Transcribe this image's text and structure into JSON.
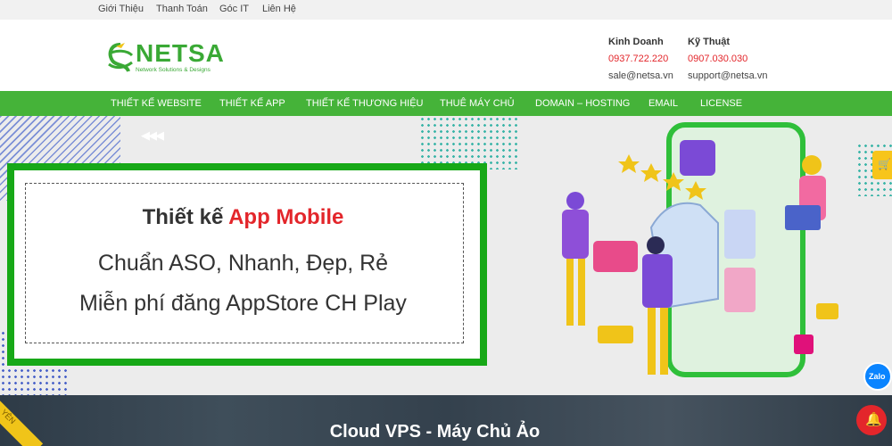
{
  "topbar": {
    "links": [
      "Giới Thiệu",
      "Thanh Toán",
      "Góc IT",
      "Liên Hệ"
    ]
  },
  "header": {
    "logo_text": "NETSA",
    "logo_tagline": "Network Solutions & Designs",
    "sales": {
      "title": "Kinh Doanh",
      "phone": "0937.722.220",
      "email": "sale@netsa.vn"
    },
    "tech": {
      "title": "Kỹ Thuật",
      "phone": "0907.030.030",
      "email": "support@netsa.vn"
    }
  },
  "nav": {
    "items": [
      "THIẾT KẾ WEBSITE",
      "THIẾT KẾ APP",
      "THIẾT KẾ THƯƠNG HIỆU",
      "THUÊ MÁY CHỦ",
      "DOMAIN – HOSTING",
      "EMAIL",
      "LICENSE"
    ]
  },
  "hero": {
    "title_prefix": "Thiết kế",
    "title_highlight": "App Mobile",
    "line2": "Chuẩn ASO, Nhanh, Đẹp, Rẻ",
    "line3": "Miễn phí đăng AppStore CH Play"
  },
  "banner": {
    "title": "Cloud VPS - Máy Chủ Ảo",
    "ribbon_text": "YÊN"
  },
  "widgets": {
    "zalo_label": "Zalo"
  },
  "colors": {
    "brand_green": "#45b339",
    "accent_red": "#e3262b",
    "frame_green": "#17a817",
    "zalo_blue": "#0a84ff",
    "cart_yellow": "#f7c51b"
  }
}
